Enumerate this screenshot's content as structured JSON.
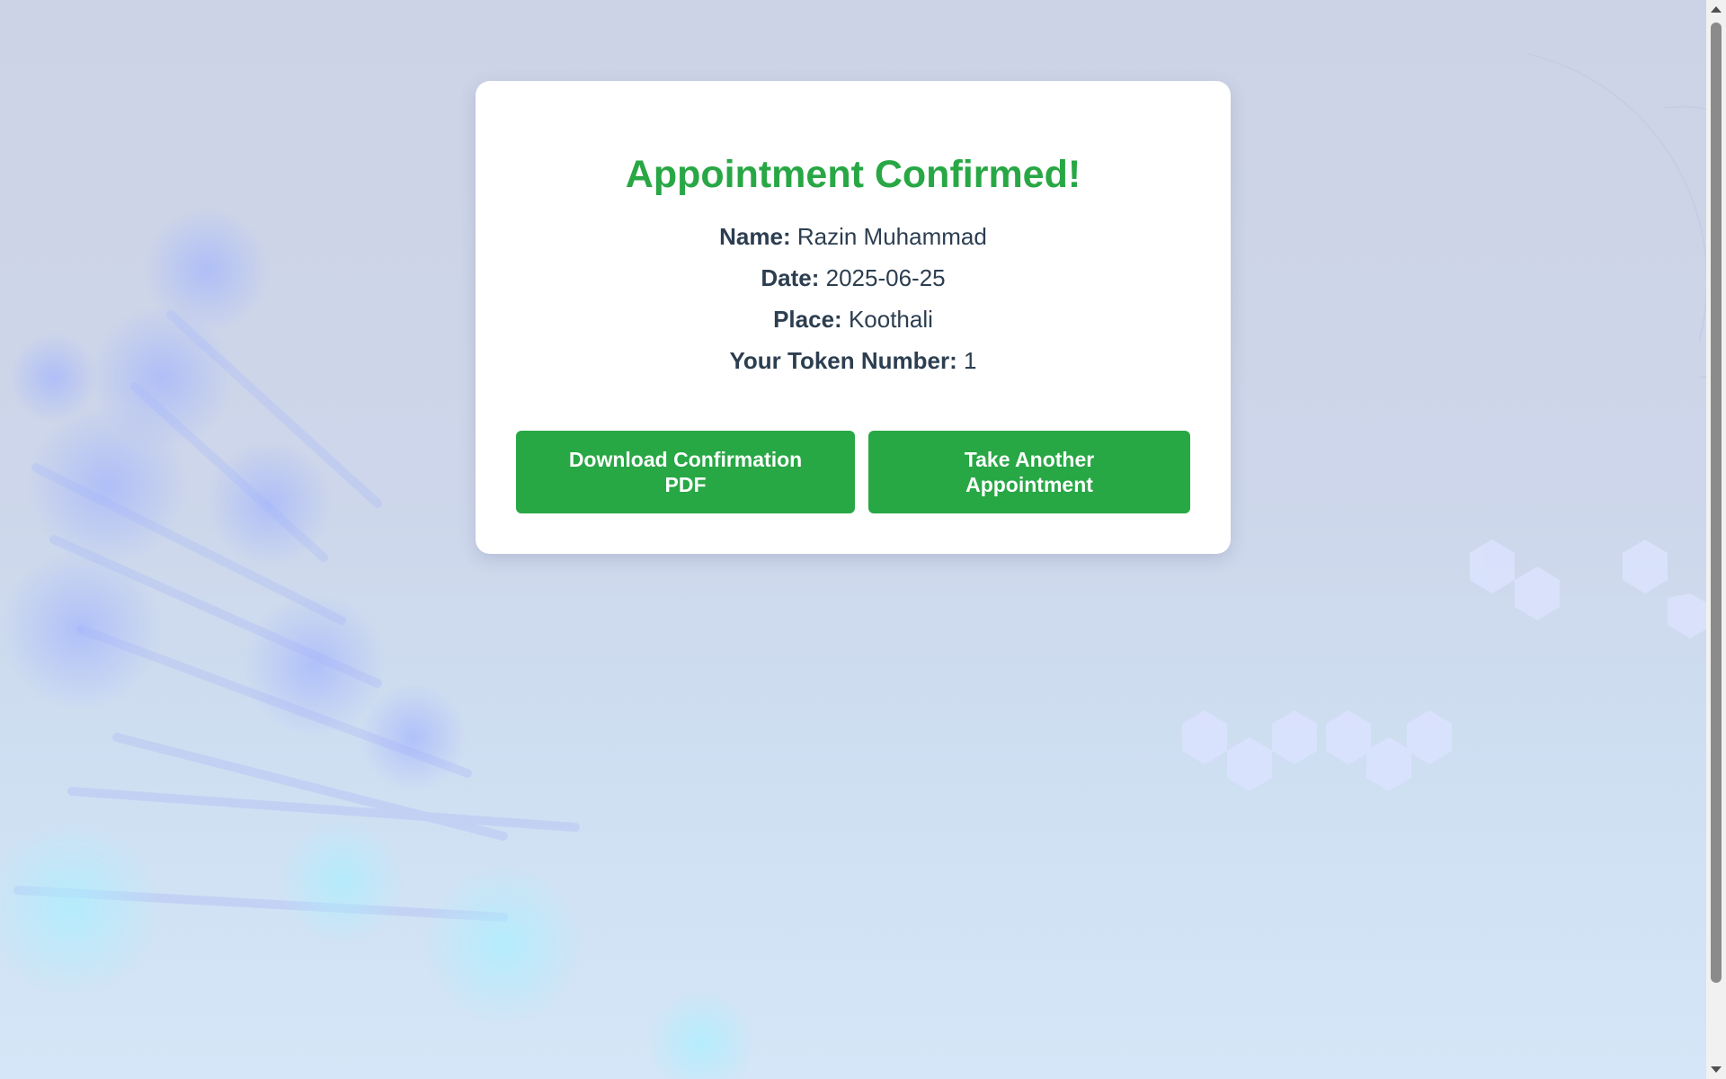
{
  "confirmation": {
    "title": "Appointment Confirmed!",
    "name_label": "Name:",
    "name_value": "Razin Muhammad",
    "date_label": "Date:",
    "date_value": "2025-06-25",
    "place_label": "Place:",
    "place_value": "Koothali",
    "token_label": "Your Token Number:",
    "token_value": "1"
  },
  "actions": {
    "download_label": "Download Confirmation PDF",
    "another_label": "Take Another Appointment"
  },
  "colors": {
    "accent": "#28a745",
    "text": "#2c3e50",
    "card": "#ffffff"
  }
}
